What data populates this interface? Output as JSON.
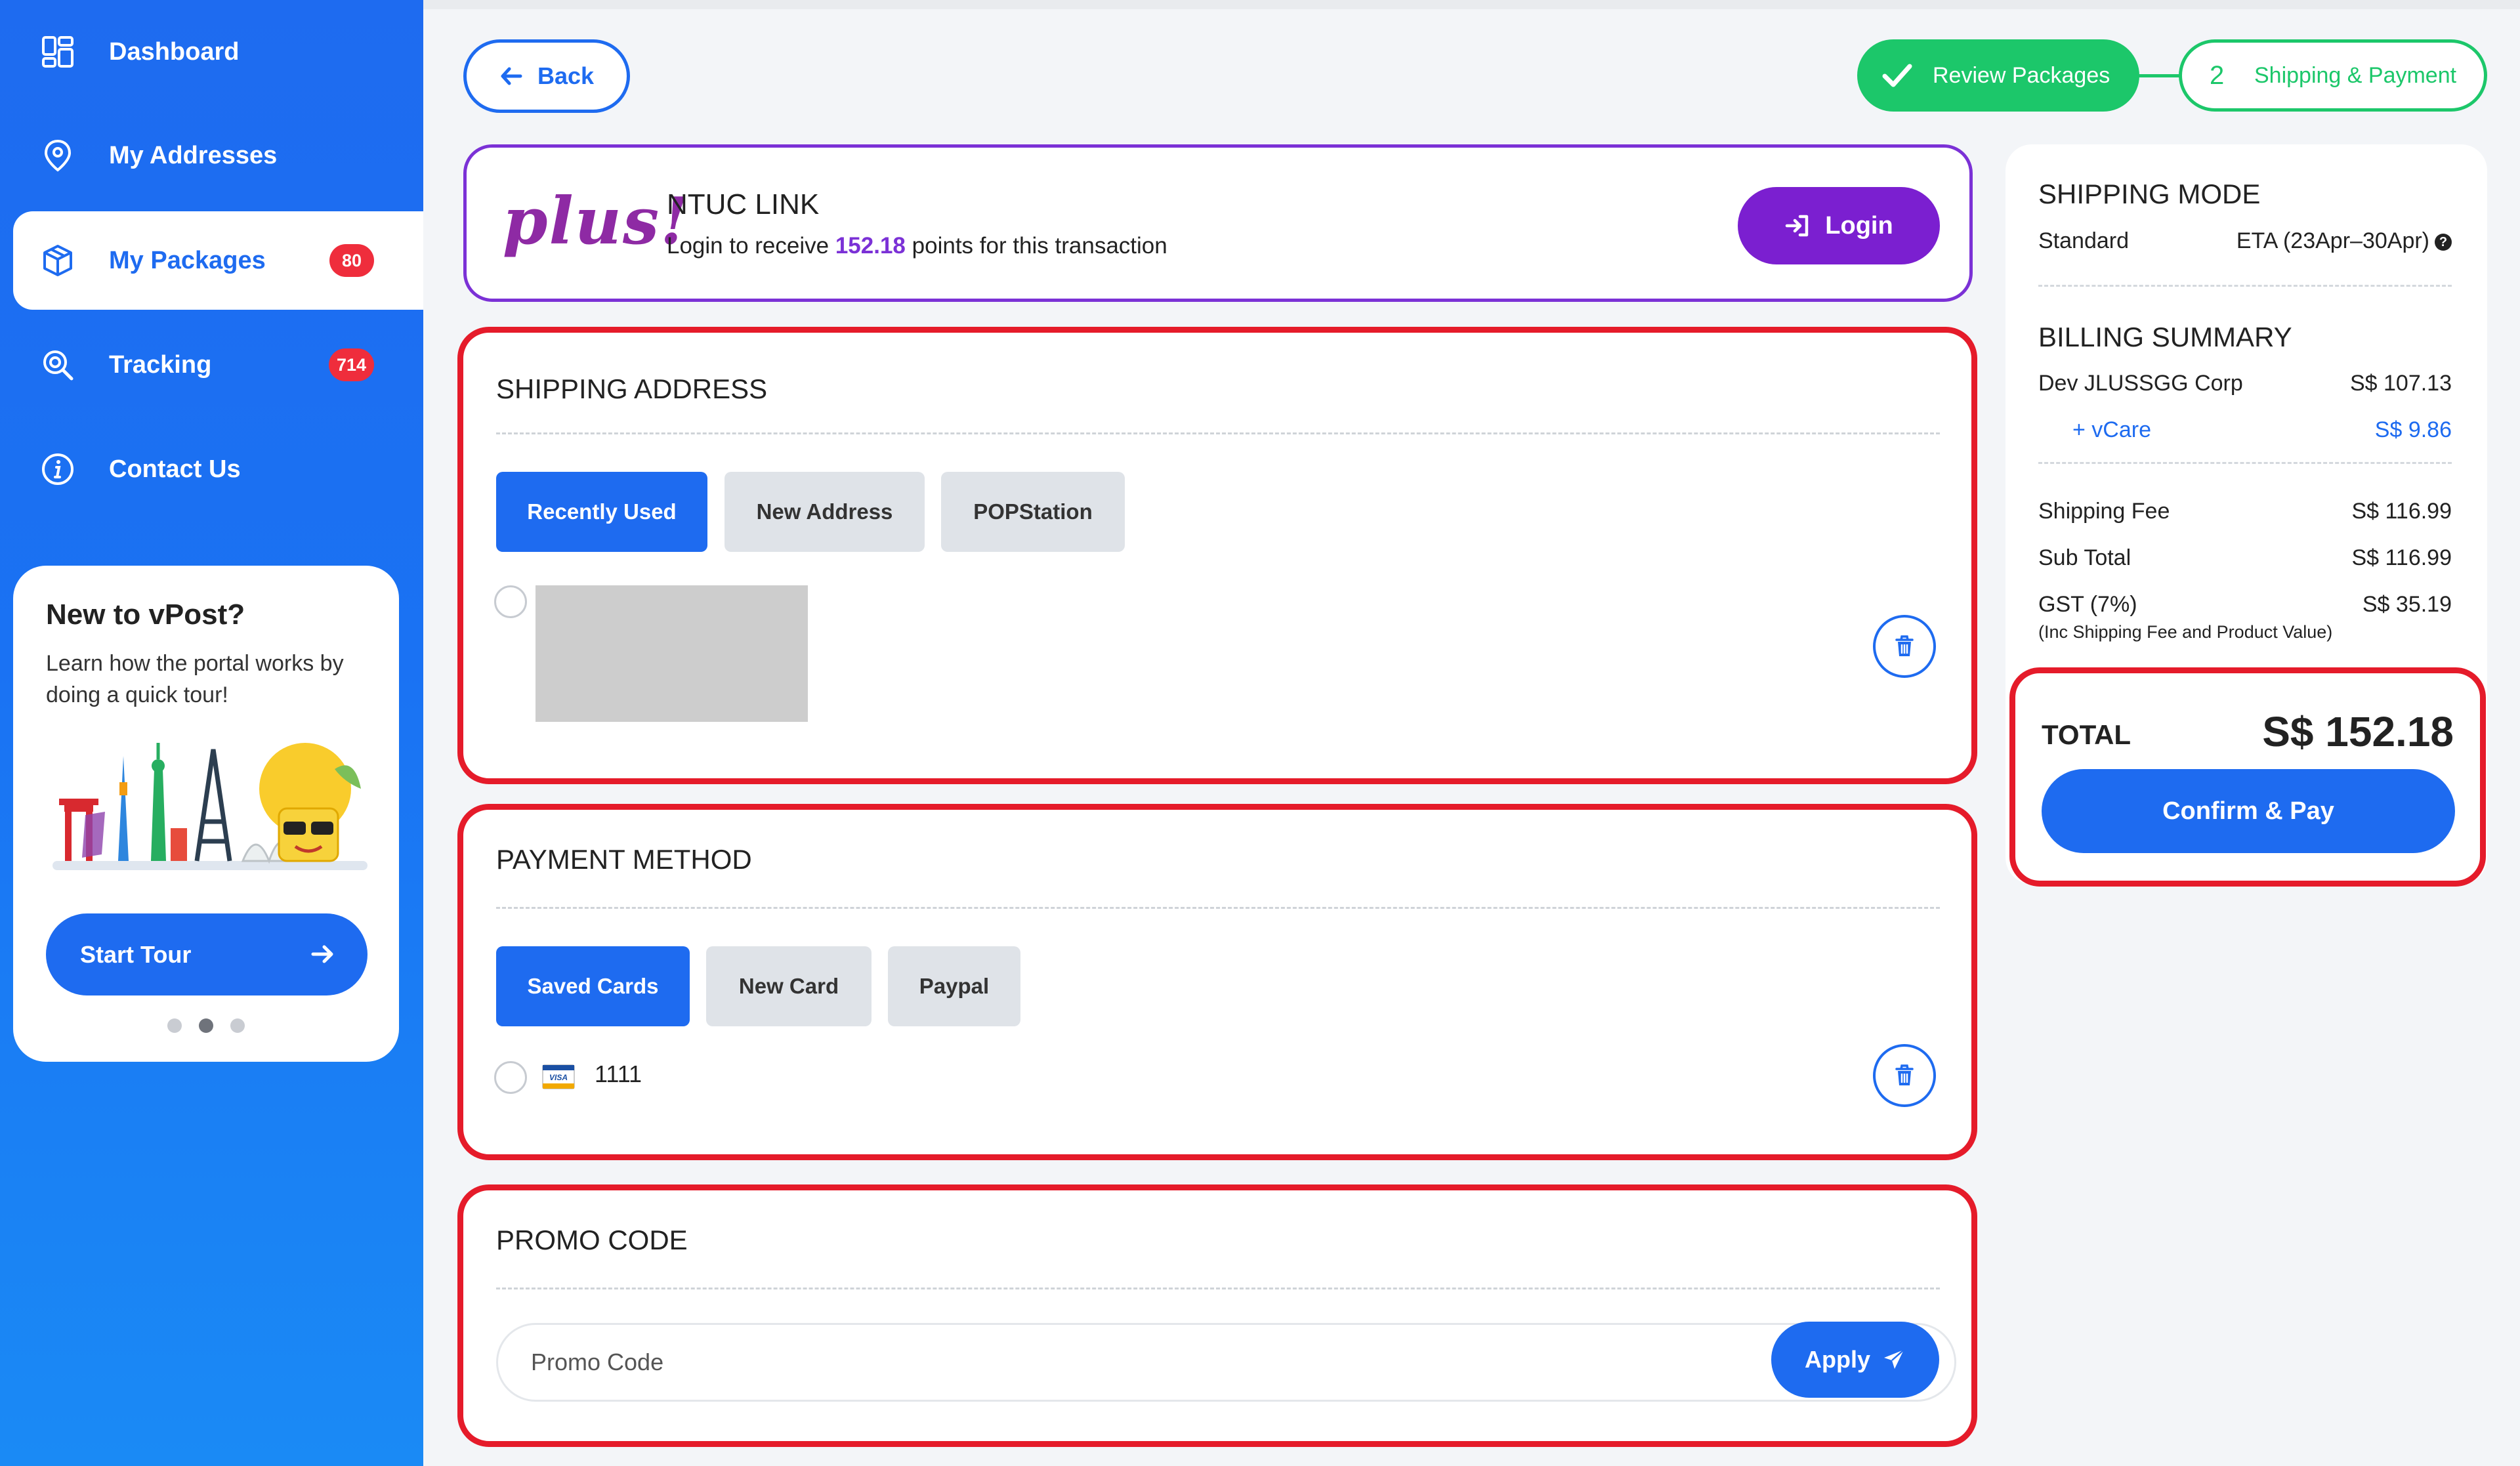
{
  "sidebar": {
    "items": [
      {
        "label": "Dashboard",
        "icon": "dashboard-icon"
      },
      {
        "label": "My Addresses",
        "icon": "location-pin-icon"
      },
      {
        "label": "My Packages",
        "icon": "package-icon",
        "badge": "80",
        "active": true
      },
      {
        "label": "Tracking",
        "icon": "tracking-icon",
        "badge": "714"
      },
      {
        "label": "Contact Us",
        "icon": "info-icon"
      }
    ],
    "tour": {
      "title": "New to vPost?",
      "text": "Learn how the portal works by doing a quick tour!",
      "button": "Start Tour"
    }
  },
  "header": {
    "back_label": "Back",
    "steps": [
      {
        "label": "Review Packages",
        "done": true
      },
      {
        "number": "2",
        "label": "Shipping & Payment"
      }
    ]
  },
  "ntuc": {
    "logo_text": "plus!",
    "title": "NTUC LINK",
    "sub_before": "Login to receive",
    "points": "152.18",
    "sub_after": "points for this transaction",
    "login_label": "Login"
  },
  "shipping_address": {
    "title": "SHIPPING ADDRESS",
    "tabs": [
      "Recently Used",
      "New Address",
      "POPStation"
    ]
  },
  "payment_method": {
    "title": "PAYMENT METHOD",
    "tabs": [
      "Saved Cards",
      "New Card",
      "Paypal"
    ],
    "card_brand": "VISA",
    "card_last4": "1111"
  },
  "promo": {
    "title": "PROMO CODE",
    "placeholder": "Promo Code",
    "apply_label": "Apply"
  },
  "summary": {
    "shipping_mode_title": "SHIPPING MODE",
    "mode": "Standard",
    "eta": "ETA (23Apr–30Apr)",
    "billing_title": "BILLING SUMMARY",
    "lines": {
      "merchant": {
        "label": "Dev JLUSSGG Corp",
        "value": "S$ 107.13"
      },
      "vcare": {
        "label": "+ vCare",
        "value": "S$ 9.86"
      },
      "shipping_fee": {
        "label": "Shipping Fee",
        "value": "S$ 116.99"
      },
      "sub_total": {
        "label": "Sub Total",
        "value": "S$ 116.99"
      },
      "gst": {
        "label": "GST (7%)",
        "value": "S$ 35.19"
      }
    },
    "gst_note": "(Inc Shipping Fee and Product Value)",
    "total_label": "TOTAL",
    "total_value": "S$ 152.18",
    "confirm_label": "Confirm & Pay"
  },
  "colors": {
    "primary": "#1e6bf0",
    "success": "#1cc76a",
    "ntuc_purple": "#7b1fd0",
    "highlight_red": "#e51b2a",
    "badge_red": "#ef2d3c"
  }
}
